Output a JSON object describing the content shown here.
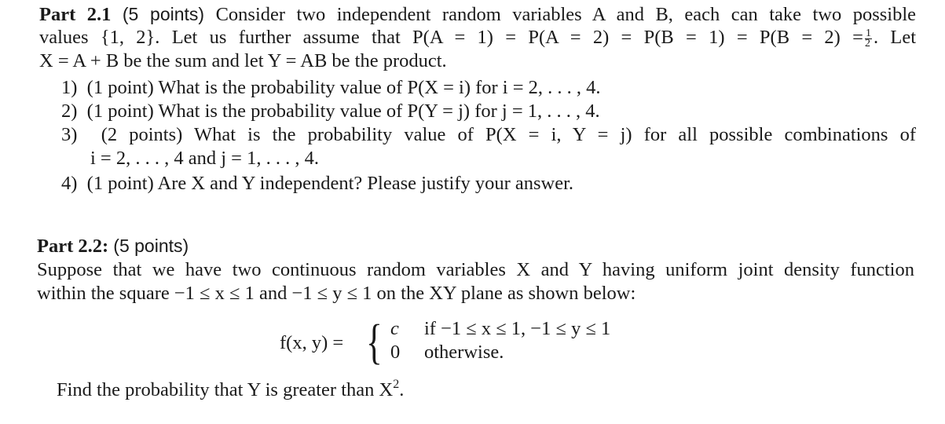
{
  "part1": {
    "title": "Part 2.1",
    "points": "(5 points)",
    "intro_line1": "Consider two independent random variables A and B, each can take two possible",
    "intro_line2_a": "values {1, 2}. Let us further assume that P(A = 1) = P(A = 2) = P(B = 1) = P(B = 2) =",
    "intro_line2_frac_num": "1",
    "intro_line2_frac_den": "2",
    "intro_line2_b": ". Let",
    "intro_line3": "X = A + B be the sum and let Y = AB be the product.",
    "questions": [
      {
        "num": "1)",
        "text": "(1 point) What is the probability value of P(X = i) for i = 2, . . . , 4."
      },
      {
        "num": "2)",
        "text": "(1 point) What is the probability value of P(Y = j) for j = 1, . . . , 4."
      },
      {
        "num": "3)",
        "text": "(2 points) What is the probability value of P(X = i, Y = j) for all possible combinations of",
        "cont": "i = 2, . . . , 4 and j = 1, . . . , 4."
      },
      {
        "num": "4)",
        "text": "(1 point) Are X and Y independent? Please justify your answer."
      }
    ]
  },
  "part2": {
    "title": "Part 2.2:",
    "points": "(5 points)",
    "line1": "Suppose that we have two continuous random variables X and Y having uniform joint density function",
    "line2": "within the square −1 ≤ x ≤ 1 and −1 ≤ y ≤ 1 on the XY plane as shown below:",
    "equation": {
      "lhs": "f(x, y) =",
      "case1_value": "c",
      "case1_condition": "if −1 ≤ x ≤ 1, −1 ≤ y ≤ 1",
      "case2_value": "0",
      "case2_condition": "otherwise."
    },
    "question_a": "Find the probability that Y is greater than X",
    "question_sup": "2",
    "question_b": "."
  }
}
